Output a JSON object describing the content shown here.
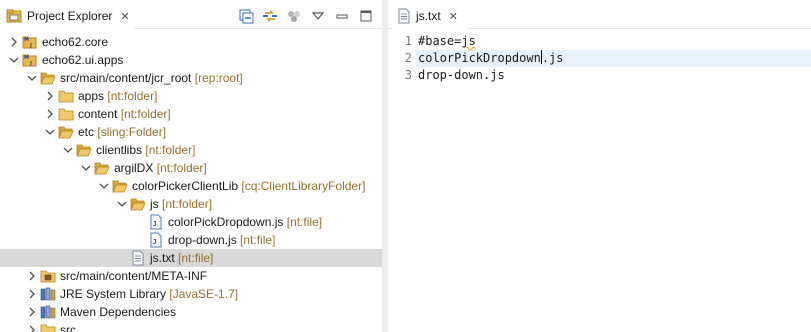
{
  "project_explorer": {
    "title": "Project Explorer",
    "close": "✕",
    "toolbar": [
      "collapse-all-icon",
      "link-with-editor-icon",
      "focus-icon",
      "view-menu-icon",
      "minimize-icon",
      "maximize-icon"
    ],
    "items": [
      {
        "name": "echo62.core",
        "decoration": "",
        "depth": 0,
        "expanded": false,
        "icon": "maven-project-icon"
      },
      {
        "name": "echo62.ui.apps",
        "decoration": "",
        "depth": 0,
        "expanded": true,
        "icon": "maven-project-icon"
      },
      {
        "name": "src/main/content/jcr_root",
        "decoration": "[rep:root]",
        "depth": 1,
        "expanded": true,
        "icon": "open-folder-icon"
      },
      {
        "name": "apps",
        "decoration": "[nt:folder]",
        "depth": 2,
        "expanded": false,
        "icon": "folder-icon"
      },
      {
        "name": "content",
        "decoration": "[nt:folder]",
        "depth": 2,
        "expanded": false,
        "icon": "folder-icon"
      },
      {
        "name": "etc",
        "decoration": "[sling:Folder]",
        "depth": 2,
        "expanded": true,
        "icon": "open-folder-icon"
      },
      {
        "name": "clientlibs",
        "decoration": "[nt:folder]",
        "depth": 3,
        "expanded": true,
        "icon": "open-folder-icon"
      },
      {
        "name": "argilDX",
        "decoration": "[nt:folder]",
        "depth": 4,
        "expanded": true,
        "icon": "open-folder-icon"
      },
      {
        "name": "colorPickerClientLib",
        "decoration": "[cq:ClientLibraryFolder]",
        "depth": 5,
        "expanded": true,
        "icon": "open-folder-icon"
      },
      {
        "name": "js",
        "decoration": "[nt:folder]",
        "depth": 6,
        "expanded": true,
        "icon": "open-folder-icon"
      },
      {
        "name": "colorPickDropdown.js",
        "decoration": "[nt:file]",
        "depth": 7,
        "expanded": null,
        "icon": "js-file-icon"
      },
      {
        "name": "drop-down.js",
        "decoration": "[nt:file]",
        "depth": 7,
        "expanded": null,
        "icon": "js-file-icon"
      },
      {
        "name": "js.txt",
        "decoration": "[nt:file]",
        "depth": 6,
        "expanded": null,
        "icon": "text-file-icon",
        "selected": true
      },
      {
        "name": "src/main/content/META-INF",
        "decoration": "",
        "depth": 1,
        "expanded": false,
        "icon": "package-folder-icon"
      },
      {
        "name": "JRE System Library",
        "decoration": "[JavaSE-1.7]",
        "depth": 1,
        "expanded": false,
        "icon": "library-icon"
      },
      {
        "name": "Maven Dependencies",
        "decoration": "",
        "depth": 1,
        "expanded": false,
        "icon": "library-icon"
      },
      {
        "name": "src",
        "decoration": "",
        "depth": 1,
        "expanded": false,
        "icon": "folder-icon"
      }
    ]
  },
  "editor": {
    "tab_title": "js.txt",
    "close": "✕",
    "lines": [
      {
        "number": "1",
        "text": "#base=js"
      },
      {
        "number": "2",
        "text": "colorPickDropdown.js"
      },
      {
        "number": "3",
        "text": "drop-down.js"
      }
    ],
    "caret": {
      "line": 2,
      "column": 18
    }
  },
  "colors": {
    "decoration": "#94712a",
    "folder": "#e8b64a",
    "selection": "#d9d9d9",
    "current_line": "#e8f2fe"
  }
}
